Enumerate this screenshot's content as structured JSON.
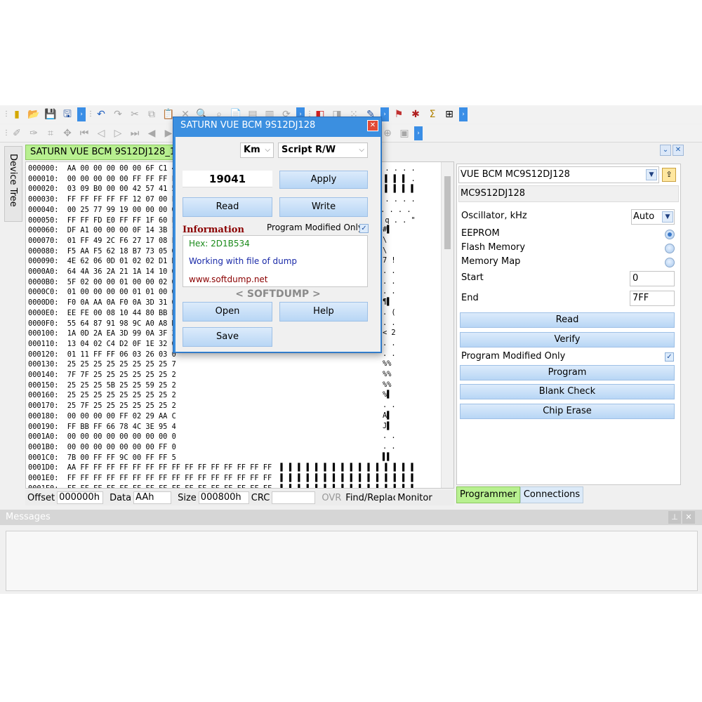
{
  "doc_tab": {
    "title": "SATURN VUE BCM 9S12DJ128_19041Km_22.05.2025.bin"
  },
  "side_tab": {
    "label": "Device Tree"
  },
  "hex_rows": [
    "000000:  AA 00 00 00 00 00 6F C1 45 F3 FF 1D 00 00 01 00  ▌ . . . . . o ▌ E ▌ ▌ . . . . .",
    "000010:  00 00 00 00 00 FF FF FF FF FF FF FF FF FF FF 07  . . . . . ▌ ▌ ▌ ▌ ▌ ▌ ▌ ▌ ▌ ▌ .",
    "000020:  03 09 B0 00 00 42 57 41 59 54 FF FF FF FF FF FF  . . ° . . B W A Y T ▌ ▌ ▌ ▌ ▌ ▌",
    "000030:  FF FF FF FF FF 12 07 00 FF FF FF 12 07 00 00 00  ▌ ▌ ▌ ▌ ▌ . . . ▌ ▌ ▌ . . . . .",
    "000040:  00 25 77 99 19 00 00 00 00 00 00 00 00 00 00 0E  . %w . . . . . . . . . . . . .",
    "000050:  FF FF FD E0 FF FF 1F 60 F9 0F 02 41 71 96 00 22  ▌ ▌ ▌ ▌ ▌ ▌ . ` ▌ . . A q . . \"",
    "000060:  DF A1 00 00 00 0F 14 3B 1",
    "000070:  01 FF 49 2C F6 27 17 08 F",
    "000080:  F5 AA F5 62 18 B7 73 05 0",
    "000090:  4E 62 06 0D 01 02 02 D1 B",
    "0000A0:  64 4A 36 2A 21 1A 14 10 0",
    "0000B0:  5F 02 00 00 01 00 00 02 0",
    "0000C0:  01 00 00 00 00 01 01 00 0",
    "0000D0:  F0 0A AA 0A F0 0A 3D 31 0",
    "0000E0:  EE FE 00 08 10 44 80 BB E",
    "0000F0:  55 64 87 91 98 9C A0 A8 D",
    "000100:  1A 0D 2A EA 3D 99 0A 3F 3",
    "000110:  13 04 02 C4 D2 0F 1E 32 0",
    "000120:  01 11 FF FF 06 03 26 03 0",
    "000130:  25 25 25 25 25 25 25 25 7",
    "000140:  7F 7F 25 25 25 25 25 25 2",
    "000150:  25 25 25 5B 25 25 59 25 2",
    "000160:  25 25 25 25 25 25 25 25 2",
    "000170:  25 7F 25 25 25 25 25 25 2",
    "000180:  00 00 00 00 FF 02 29 AA C",
    "000190:  FF BB FF 66 78 4C 3E 95 4",
    "0001A0:  00 00 00 00 00 00 00 00 0",
    "0001B0:  00 00 00 00 00 00 00 FF 0",
    "0001C0:  7B 00 FF FF 9C 00 FF FF 5",
    "0001D0:  AA FF FF FF FF FF FF FF FF FF FF FF FF FF FF FF  ▌ ▌ ▌ ▌ ▌ ▌ ▌ ▌ ▌ ▌ ▌ ▌ ▌ ▌ ▌ ▌",
    "0001E0:  FF FF FF FF FF FF FF FF FF FF FF FF FF FF FF FF  ▌ ▌ ▌ ▌ ▌ ▌ ▌ ▌ ▌ ▌ ▌ ▌ ▌ ▌ ▌ ▌",
    "0001F0:  FF FF FF FF FF FF FF FF FF FF FF FF FF FF FF FF  ▌ ▌ ▌ ▌ ▌ ▌ ▌ ▌ ▌ ▌ ▌ ▌ ▌ ▌ ▌ ▌"
  ],
  "hex_right_fragments": [
    {
      "row": 6,
      "text": "#▌"
    },
    {
      "row": 7,
      "text": "\\"
    },
    {
      "row": 8,
      "text": "\\"
    },
    {
      "row": 9,
      "text": "7 !"
    },
    {
      "row": 10,
      "text": ". ."
    },
    {
      "row": 11,
      "text": ". ."
    },
    {
      "row": 12,
      "text": ". ."
    },
    {
      "row": 13,
      "text": "¶▌"
    },
    {
      "row": 14,
      "text": ". ("
    },
    {
      "row": 15,
      "text": ". ."
    },
    {
      "row": 16,
      "text": "< 2"
    },
    {
      "row": 17,
      "text": ". ."
    },
    {
      "row": 18,
      "text": ". ."
    },
    {
      "row": 19,
      "text": "%%"
    },
    {
      "row": 20,
      "text": "%%"
    },
    {
      "row": 21,
      "text": "%%"
    },
    {
      "row": 22,
      "text": "%▌"
    },
    {
      "row": 23,
      "text": ". ."
    },
    {
      "row": 24,
      "text": "A▌"
    },
    {
      "row": 25,
      "text": "J▌"
    },
    {
      "row": 26,
      "text": ". ."
    },
    {
      "row": 27,
      "text": ". ."
    },
    {
      "row": 28,
      "text": "▌▌"
    }
  ],
  "status": {
    "offset_label": "Offset",
    "offset_value": "000000h",
    "data_label": "Data",
    "data_value": "AAh",
    "size_label": "Size",
    "size_value": "000800h",
    "crc_label": "CRC",
    "crc_value": "",
    "ovr": "OVR",
    "find": "Find/Replace",
    "monitor": "Monitor"
  },
  "programmer": {
    "device": "VUE BCM MC9S12DJ128",
    "chip": "MC9S12DJ128",
    "oscillator_label": "Oscillator, kHz",
    "oscillator_value": "Auto",
    "eeprom_label": "EEPROM",
    "flash_label": "Flash Memory",
    "memmap_label": "Memory Map",
    "start_label": "Start",
    "start_value": "0",
    "end_label": "End",
    "end_value": "7FF",
    "read": "Read",
    "verify": "Verify",
    "modified_only": "Program Modified Only",
    "program": "Program",
    "blank_check": "Blank Check",
    "chip_erase": "Chip Erase"
  },
  "bottom_tabs": {
    "programmer": "Programmer",
    "connections": "Connections"
  },
  "messages": {
    "title": "Messages"
  },
  "dialog": {
    "title": "SATURN VUE BCM 9S12DJ128",
    "unit": "Km",
    "mode": "Script R/W",
    "km_value": "19041",
    "apply": "Apply",
    "read": "Read",
    "write": "Write",
    "info_title": "Information",
    "modified_only": "Program Modified Only",
    "hex_line": "Hex: 2D1B534",
    "working_line": "Working with file of dump",
    "site_line": "www.softdump.net",
    "brand": "< SOFTDUMP >",
    "open": "Open",
    "help": "Help",
    "save": "Save"
  },
  "colors": {
    "accent": "#3b8fe0",
    "tab_active": "#b8f090",
    "button": "#c8e0f8",
    "close": "#e24a36"
  }
}
